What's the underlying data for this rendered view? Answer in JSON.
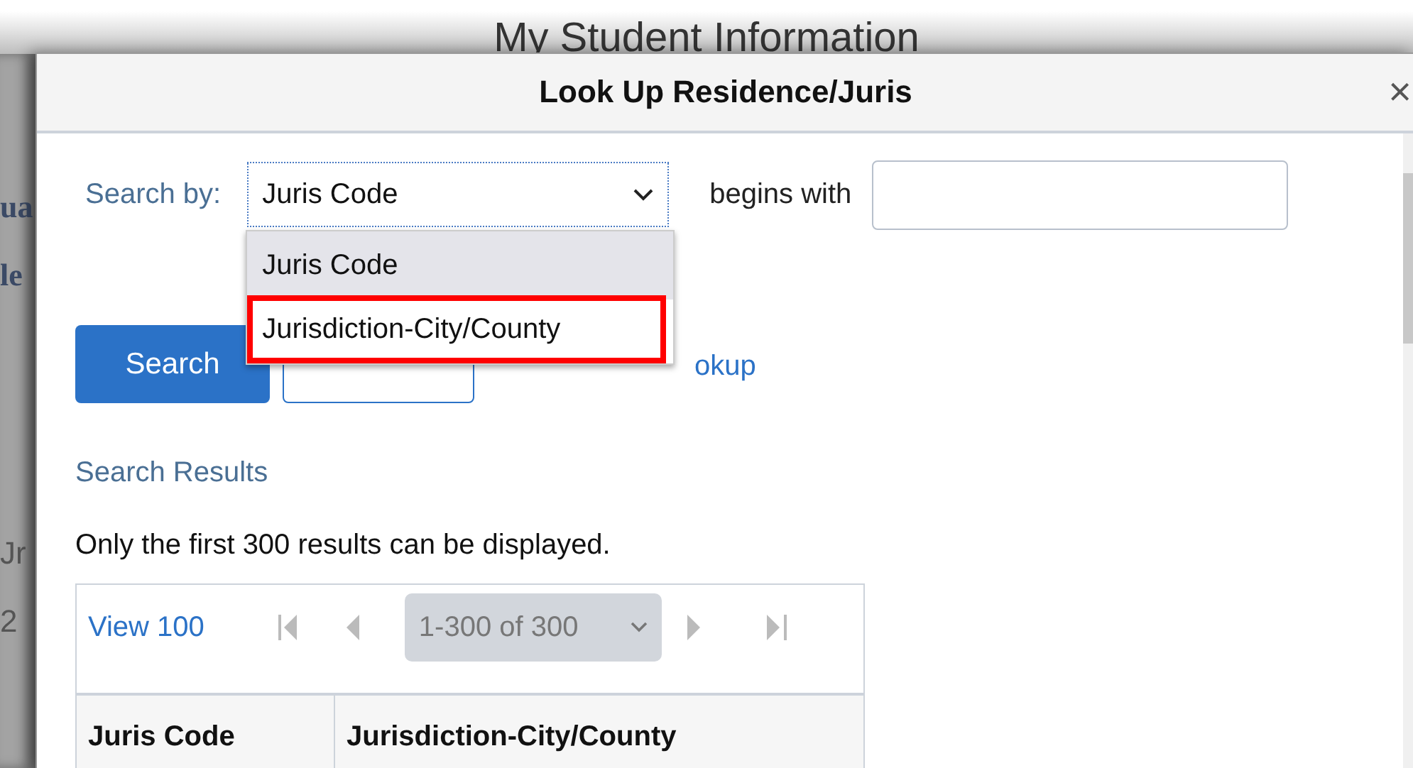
{
  "background_page": {
    "title": "My Student Information",
    "fragments": [
      "ua",
      "le",
      "Jr",
      "2"
    ]
  },
  "dialog": {
    "title": "Look Up Residence/Juris",
    "close": "×"
  },
  "search": {
    "label": "Search by:",
    "select_value": "Juris Code",
    "operator": "begins with",
    "options": [
      {
        "label": "Juris Code",
        "selected": true,
        "highlighted": false
      },
      {
        "label": "Jurisdiction-City/County",
        "selected": false,
        "highlighted": true
      }
    ],
    "button": "Search",
    "link": "okup"
  },
  "results": {
    "heading": "Search Results",
    "note": "Only the first 300 results can be displayed.",
    "view_link": "View 100",
    "range": "1-300 of 300",
    "columns": [
      "Juris Code",
      "Jurisdiction-City/County"
    ]
  }
}
